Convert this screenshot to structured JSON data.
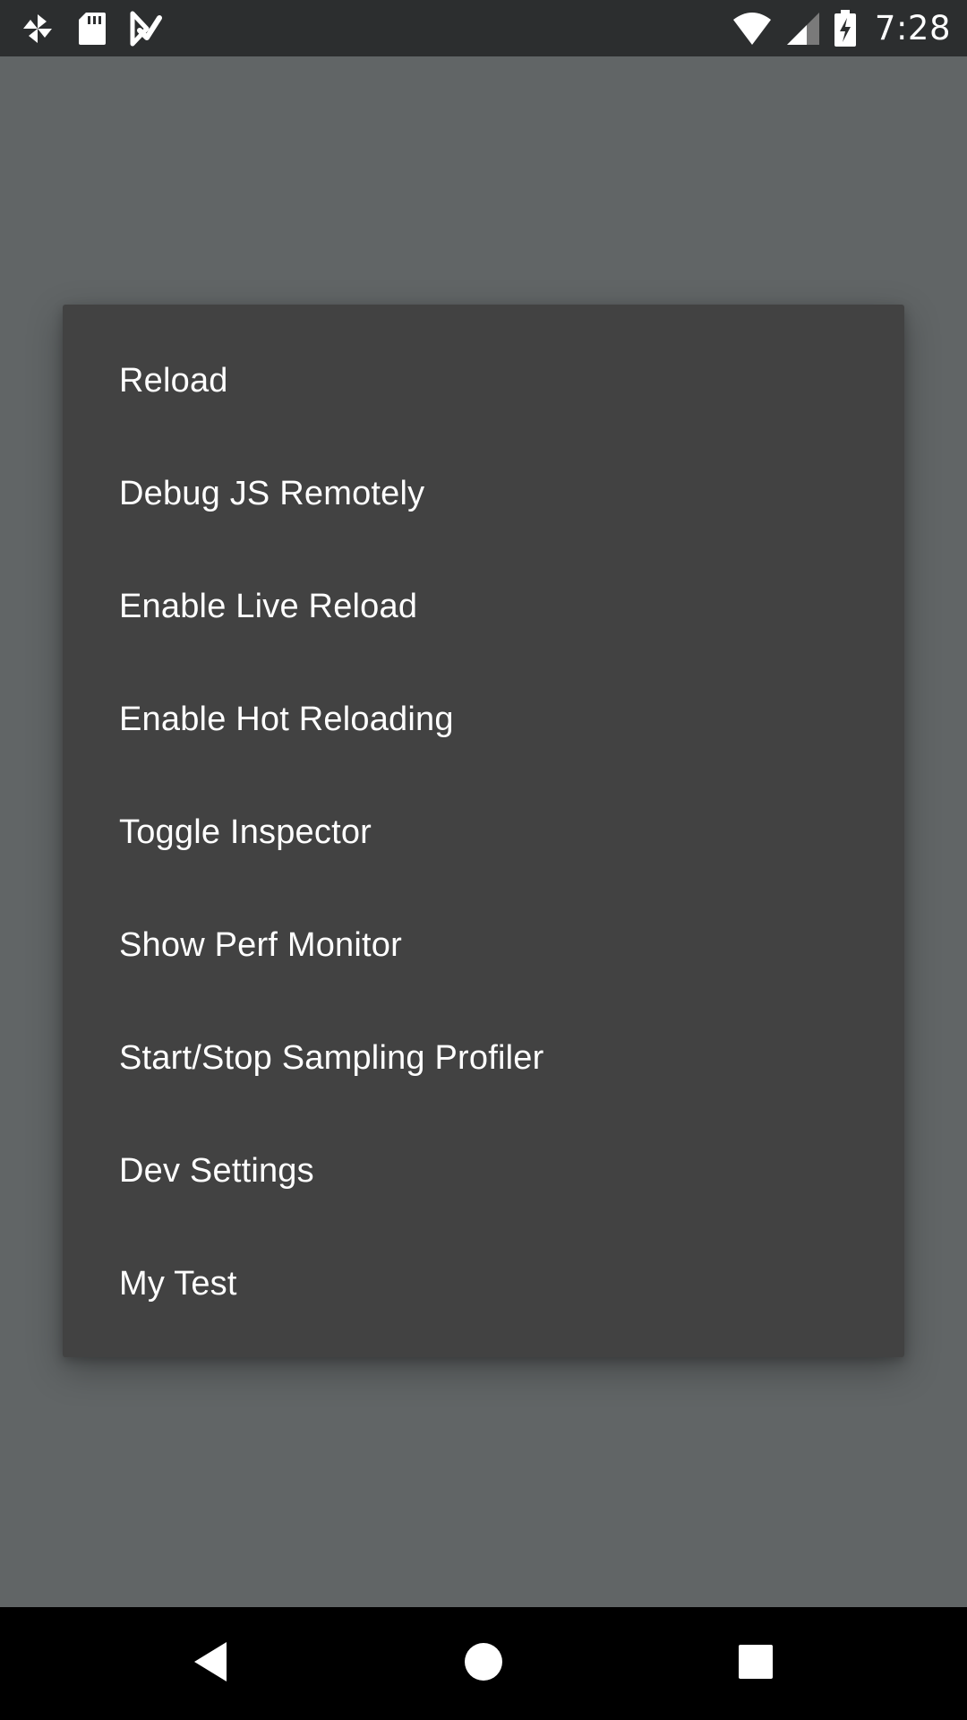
{
  "status_bar": {
    "time": "7:28",
    "left_icons": [
      "pinwheel-icon",
      "sd-card-icon",
      "play-store-icon"
    ],
    "right_icons": [
      "wifi-icon",
      "cell-signal-icon",
      "battery-charging-icon"
    ]
  },
  "dialog": {
    "items": [
      {
        "label": "Reload"
      },
      {
        "label": "Debug JS Remotely"
      },
      {
        "label": "Enable Live Reload"
      },
      {
        "label": "Enable Hot Reloading"
      },
      {
        "label": "Toggle Inspector"
      },
      {
        "label": "Show Perf Monitor"
      },
      {
        "label": "Start/Stop Sampling Profiler"
      },
      {
        "label": "Dev Settings"
      },
      {
        "label": "My Test"
      }
    ]
  },
  "nav_bar": {
    "buttons": [
      "back-icon",
      "home-icon",
      "recents-icon"
    ]
  },
  "colors": {
    "status_bar": "#2c2e2f",
    "scrim": "#616566",
    "dialog": "#424242",
    "nav_bar": "#000000",
    "text": "#ffffff"
  }
}
